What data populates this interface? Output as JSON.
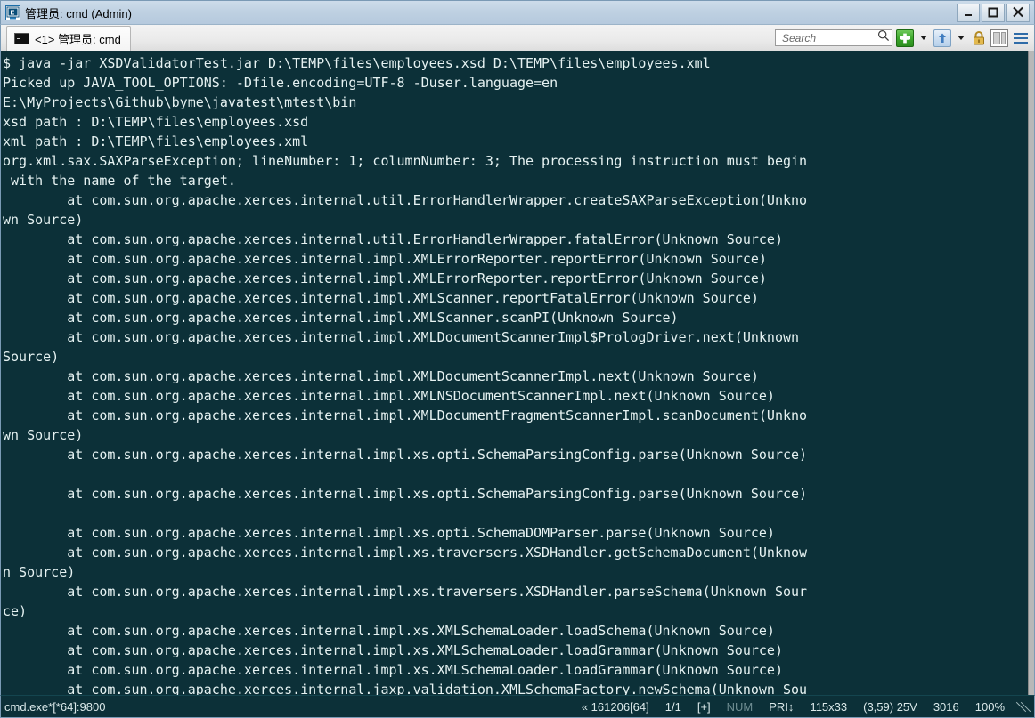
{
  "window": {
    "title": "管理员: cmd (Admin)",
    "icon": "console-window-icon",
    "minimize_label": "Minimize",
    "maximize_label": "Maximize",
    "close_label": "Close"
  },
  "tabs": [
    {
      "label": "<1> 管理员: cmd",
      "icon": "console-icon",
      "active": true
    }
  ],
  "toolbar": {
    "search_placeholder": "Search",
    "search_value": "",
    "new_tab_label": "New Tab",
    "new_tab_dropdown_label": "New Tab Options",
    "info_label": "Info",
    "info_dropdown_label": "Info Options",
    "lock_label": "Lock",
    "panes_label": "Toggle Panes",
    "menu_label": "Menu"
  },
  "terminal": {
    "background_color": "#0c3038",
    "text_color": "#e6f2f2",
    "lines": [
      "$ java -jar XSDValidatorTest.jar D:\\TEMP\\files\\employees.xsd D:\\TEMP\\files\\employees.xml",
      "Picked up JAVA_TOOL_OPTIONS: -Dfile.encoding=UTF-8 -Duser.language=en",
      "E:\\MyProjects\\Github\\byme\\javatest\\mtest\\bin",
      "xsd path : D:\\TEMP\\files\\employees.xsd",
      "xml path : D:\\TEMP\\files\\employees.xml",
      "org.xml.sax.SAXParseException; lineNumber: 1; columnNumber: 3; The processing instruction must begin",
      " with the name of the target.",
      "        at com.sun.org.apache.xerces.internal.util.ErrorHandlerWrapper.createSAXParseException(Unkno",
      "wn Source)",
      "        at com.sun.org.apache.xerces.internal.util.ErrorHandlerWrapper.fatalError(Unknown Source)",
      "        at com.sun.org.apache.xerces.internal.impl.XMLErrorReporter.reportError(Unknown Source)",
      "        at com.sun.org.apache.xerces.internal.impl.XMLErrorReporter.reportError(Unknown Source)",
      "        at com.sun.org.apache.xerces.internal.impl.XMLScanner.reportFatalError(Unknown Source)",
      "        at com.sun.org.apache.xerces.internal.impl.XMLScanner.scanPI(Unknown Source)",
      "        at com.sun.org.apache.xerces.internal.impl.XMLDocumentScannerImpl$PrologDriver.next(Unknown",
      "Source)",
      "        at com.sun.org.apache.xerces.internal.impl.XMLDocumentScannerImpl.next(Unknown Source)",
      "        at com.sun.org.apache.xerces.internal.impl.XMLNSDocumentScannerImpl.next(Unknown Source)",
      "        at com.sun.org.apache.xerces.internal.impl.XMLDocumentFragmentScannerImpl.scanDocument(Unkno",
      "wn Source)",
      "        at com.sun.org.apache.xerces.internal.impl.xs.opti.SchemaParsingConfig.parse(Unknown Source)",
      "",
      "        at com.sun.org.apache.xerces.internal.impl.xs.opti.SchemaParsingConfig.parse(Unknown Source)",
      "",
      "        at com.sun.org.apache.xerces.internal.impl.xs.opti.SchemaDOMParser.parse(Unknown Source)",
      "        at com.sun.org.apache.xerces.internal.impl.xs.traversers.XSDHandler.getSchemaDocument(Unknow",
      "n Source)",
      "        at com.sun.org.apache.xerces.internal.impl.xs.traversers.XSDHandler.parseSchema(Unknown Sour",
      "ce)",
      "        at com.sun.org.apache.xerces.internal.impl.xs.XMLSchemaLoader.loadSchema(Unknown Source)",
      "        at com.sun.org.apache.xerces.internal.impl.xs.XMLSchemaLoader.loadGrammar(Unknown Source)",
      "        at com.sun.org.apache.xerces.internal.impl.xs.XMLSchemaLoader.loadGrammar(Unknown Source)",
      "        at com.sun.org.apache.xerces.internal.jaxp.validation.XMLSchemaFactory.newSchema(Unknown Sou"
    ]
  },
  "statusbar": {
    "process": "cmd.exe*[*64]:9800",
    "build": "« 161206[64]",
    "page": "1/1",
    "plus": "[+]",
    "num": "NUM",
    "pri": "PRI↕",
    "size": "115x33",
    "cursor": "(3,59) 25V",
    "lines": "3016",
    "zoom": "100%"
  }
}
